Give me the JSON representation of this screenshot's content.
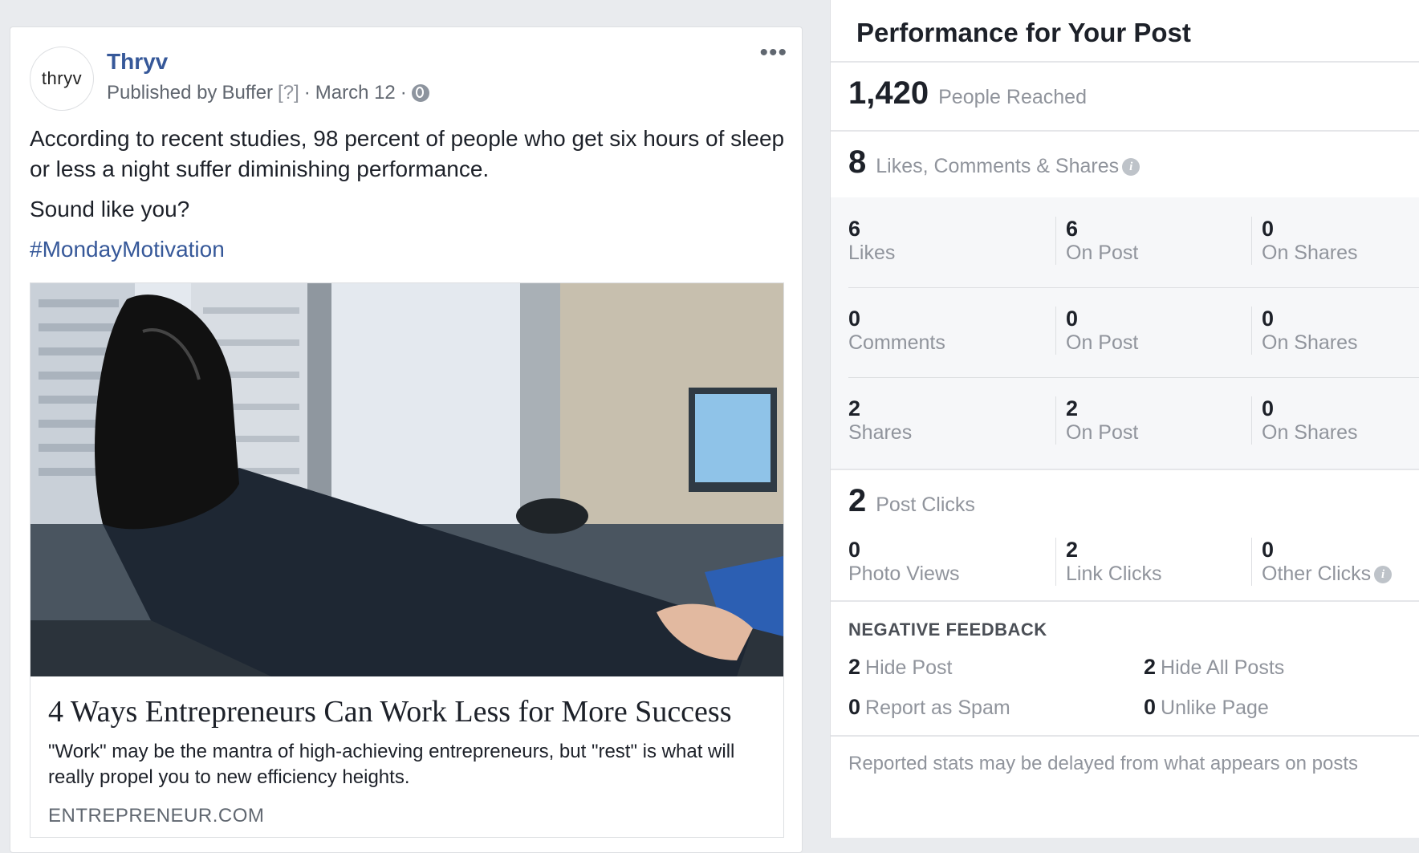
{
  "post": {
    "page_name": "Thryv",
    "avatar_text": "thryv",
    "published_by_prefix": "Published by",
    "publisher": "Buffer",
    "publisher_hint": "[?]",
    "separator": "·",
    "date": "March 12",
    "more_label": "•••",
    "text_line1": "According to recent studies, 98 percent of people who get six hours of sleep or less a night suffer diminishing performance.",
    "text_line2": "Sound like you?",
    "hashtag": "#MondayMotivation",
    "link": {
      "title": "4 Ways Entrepreneurs Can Work Less for More Success",
      "description": "\"Work\" may be the mantra of high-achieving entrepreneurs, but \"rest\" is what will really propel you to new efficiency heights.",
      "domain": "ENTREPRENEUR.COM"
    }
  },
  "performance": {
    "title": "Performance for Your Post",
    "reached": {
      "value": "1,420",
      "label": "People Reached"
    },
    "engagement": {
      "value": "8",
      "label": "Likes, Comments & Shares",
      "icon": "info-icon"
    },
    "rows": [
      {
        "c1": {
          "value": "6",
          "label": "Likes"
        },
        "c2": {
          "value": "6",
          "label": "On Post"
        },
        "c3": {
          "value": "0",
          "label": "On Shares"
        }
      },
      {
        "c1": {
          "value": "0",
          "label": "Comments"
        },
        "c2": {
          "value": "0",
          "label": "On Post"
        },
        "c3": {
          "value": "0",
          "label": "On Shares"
        }
      },
      {
        "c1": {
          "value": "2",
          "label": "Shares"
        },
        "c2": {
          "value": "2",
          "label": "On Post"
        },
        "c3": {
          "value": "0",
          "label": "On Shares"
        }
      }
    ],
    "clicks": {
      "value": "2",
      "label": "Post Clicks",
      "photo_views": {
        "value": "0",
        "label": "Photo Views"
      },
      "link_clicks": {
        "value": "2",
        "label": "Link Clicks"
      },
      "other_clicks": {
        "value": "0",
        "label": "Other Clicks"
      }
    },
    "negative": {
      "heading": "NEGATIVE FEEDBACK",
      "hide_post": {
        "value": "2",
        "label": "Hide Post"
      },
      "hide_all": {
        "value": "2",
        "label": "Hide All Posts"
      },
      "spam": {
        "value": "0",
        "label": "Report as Spam"
      },
      "unlike": {
        "value": "0",
        "label": "Unlike Page"
      }
    },
    "footer_note": "Reported stats may be delayed from what appears on posts"
  }
}
